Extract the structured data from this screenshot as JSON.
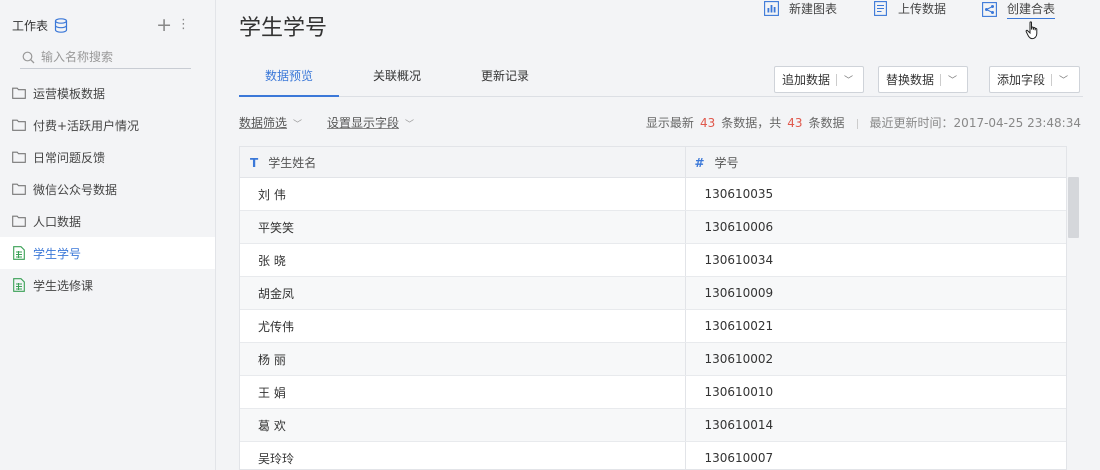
{
  "sidebar": {
    "title": "工作表",
    "search_placeholder": "输入名称搜索",
    "items": [
      {
        "label": "运营模板数据",
        "icon": "folder-icon",
        "active": false
      },
      {
        "label": "付费+活跃用户情况",
        "icon": "folder-icon",
        "active": false
      },
      {
        "label": "日常问题反馈",
        "icon": "folder-icon",
        "active": false
      },
      {
        "label": "微信公众号数据",
        "icon": "folder-icon",
        "active": false
      },
      {
        "label": "人口数据",
        "icon": "folder-icon",
        "active": false
      },
      {
        "label": "学生学号",
        "icon": "sheet-icon",
        "active": true
      },
      {
        "label": "学生选修课",
        "icon": "sheet-icon",
        "active": false
      }
    ]
  },
  "header": {
    "title": "学生学号",
    "actions": [
      "新建图表",
      "上传数据",
      "创建合表"
    ]
  },
  "tabs": [
    "数据预览",
    "关联概况",
    "更新记录"
  ],
  "toolbar": {
    "append": "追加数据",
    "replace": "替换数据",
    "add_field": "添加字段"
  },
  "filters": {
    "data_filter": "数据筛选",
    "display_fields": "设置显示字段"
  },
  "status": {
    "prefix": "显示最新",
    "shown": "43",
    "mid": "条数据，共",
    "total": "43",
    "suffix": "条数据",
    "updated_label": "最近更新时间：",
    "updated_time": "2017-04-25 23:48:34"
  },
  "table": {
    "columns": [
      {
        "type": "T",
        "name": "学生姓名"
      },
      {
        "type": "#",
        "name": "学号"
      }
    ],
    "rows": [
      [
        "刘 伟",
        "130610035"
      ],
      [
        "平笑笑",
        "130610006"
      ],
      [
        "张 晓",
        "130610034"
      ],
      [
        "胡金凤",
        "130610009"
      ],
      [
        "尤传伟",
        "130610021"
      ],
      [
        "杨 丽",
        "130610002"
      ],
      [
        "王 娟",
        "130610010"
      ],
      [
        "葛 欢",
        "130610014"
      ],
      [
        "吴玲玲",
        "130610007"
      ]
    ]
  },
  "colors": {
    "accent": "#3b78d8",
    "sheet_icon": "#3aa055",
    "count_highlight": "#e0584c"
  }
}
